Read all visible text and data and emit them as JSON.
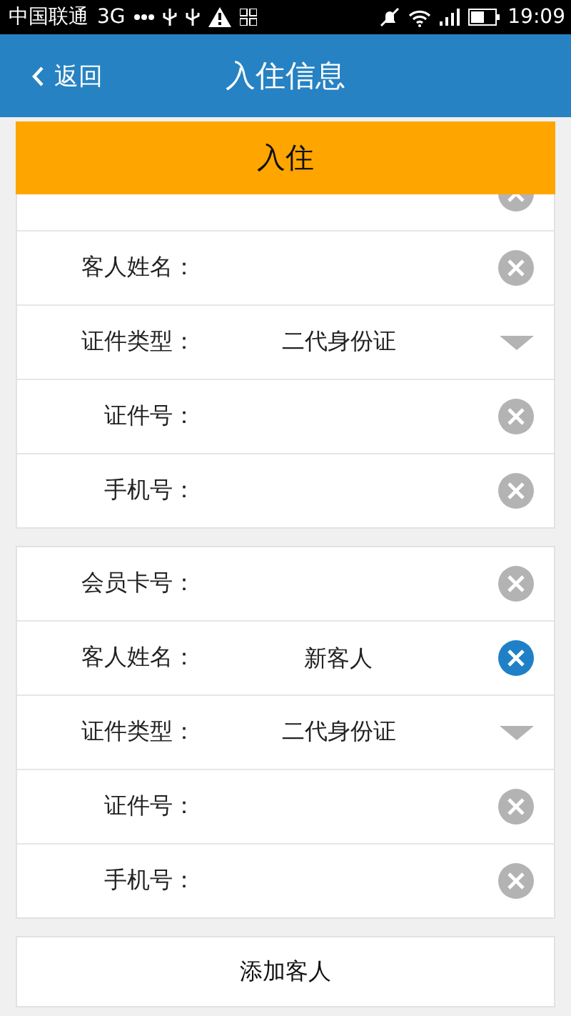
{
  "status_bar": {
    "carrier": "中国联通",
    "network": "3G",
    "time": "19:09"
  },
  "nav": {
    "back": "返回",
    "title": "入住信息"
  },
  "banner": "入住",
  "cards": [
    {
      "rows": [
        {
          "kind": "text",
          "focused": false
        },
        {
          "kind": "text",
          "label": "客人姓名：",
          "focused": false
        },
        {
          "kind": "select",
          "label": "证件类型：",
          "value": "二代身份证"
        },
        {
          "kind": "text",
          "label": "证件号：",
          "focused": false
        },
        {
          "kind": "text",
          "label": "手机号：",
          "focused": false
        }
      ]
    },
    {
      "rows": [
        {
          "kind": "text",
          "label": "会员卡号：",
          "focused": false
        },
        {
          "kind": "text",
          "label": "客人姓名：",
          "value": "新客人",
          "focused": true
        },
        {
          "kind": "select",
          "label": "证件类型：",
          "value": "二代身份证"
        },
        {
          "kind": "text",
          "label": "证件号：",
          "focused": false
        },
        {
          "kind": "text",
          "label": "手机号：",
          "focused": false
        }
      ]
    }
  ],
  "add_button": "添加客人"
}
